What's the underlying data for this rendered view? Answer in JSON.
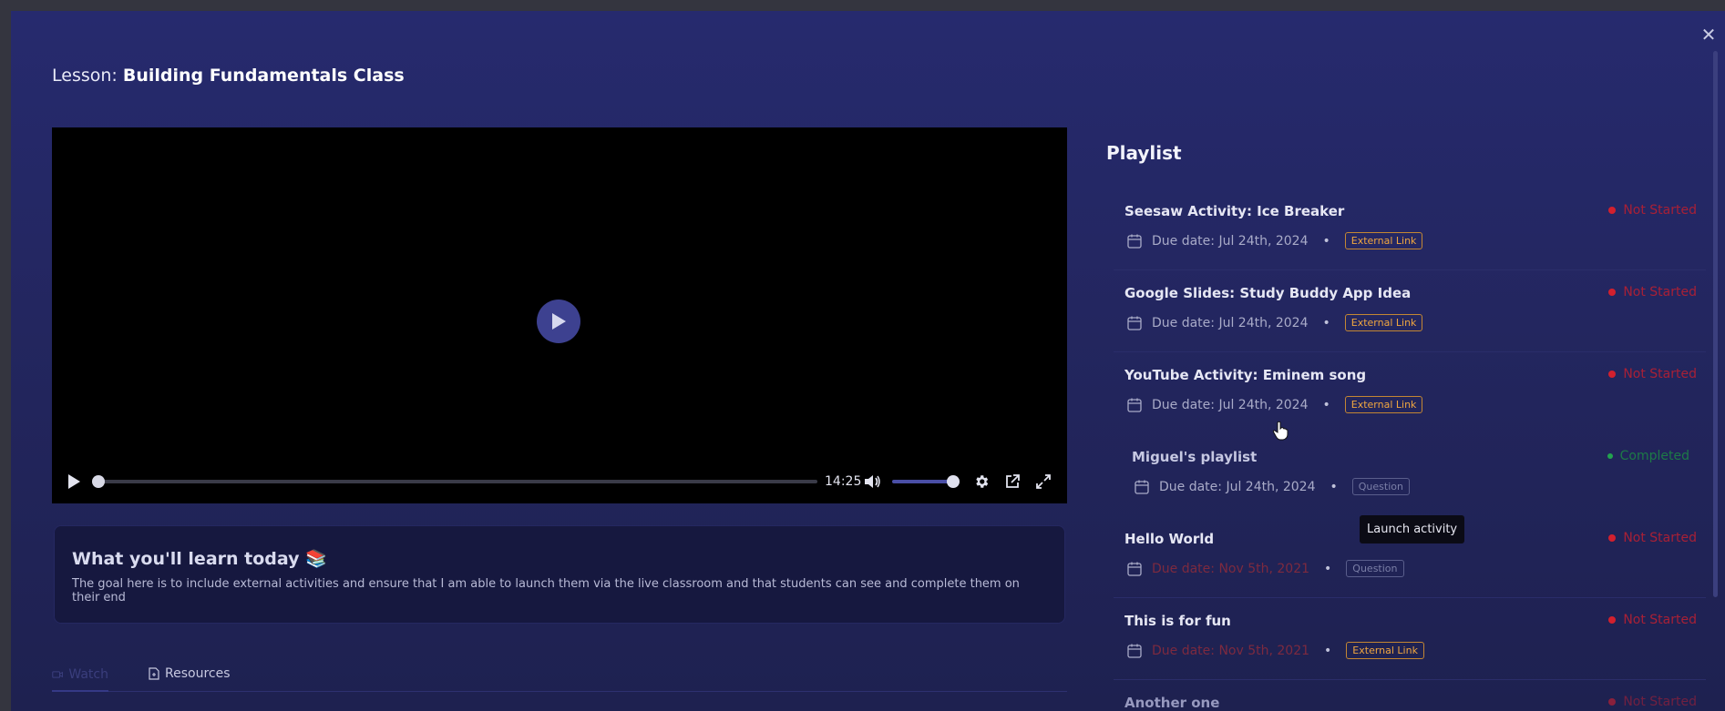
{
  "lesson": {
    "prefix": "Lesson:",
    "name": "Building Fundamentals Class"
  },
  "video": {
    "time": "14:25"
  },
  "learn": {
    "heading": "What you'll learn today 📚",
    "body": "The goal here is to include external activities and ensure that I am able to launch them via the live classroom and that students can see and complete them on their end"
  },
  "tabs": [
    {
      "label": "Watch"
    },
    {
      "label": "Resources"
    }
  ],
  "playlist": {
    "title": "Playlist",
    "items": [
      {
        "title": "Seesaw Activity: Ice Breaker",
        "due": "Due date: Jul 24th, 2024",
        "type": "External Link",
        "status": "Not Started"
      },
      {
        "title": "Google Slides: Study Buddy App Idea",
        "due": "Due date: Jul 24th, 2024",
        "type": "External Link",
        "status": "Not Started"
      },
      {
        "title": "YouTube Activity: Eminem song",
        "due": "Due date: Jul 24th, 2024",
        "type": "External Link",
        "status": "Not Started"
      },
      {
        "title": "Miguel's playlist",
        "due": "Due date: Jul 24th, 2024",
        "type": "Question",
        "status": "Completed"
      },
      {
        "title": "Hello World",
        "due": "Due date: Nov 5th, 2021",
        "type": "Question",
        "status": "Not Started"
      },
      {
        "title": "This is for fun",
        "due": "Due date: Nov 5th, 2021",
        "type": "External Link",
        "status": "Not Started"
      },
      {
        "title": "Another one",
        "status": "Not Started"
      }
    ]
  },
  "tooltip": "Launch activity",
  "colors": {
    "accent": "#3d4190",
    "not_started": "#d2202e",
    "completed": "#22a34e",
    "external_badge": "#f0a640"
  }
}
